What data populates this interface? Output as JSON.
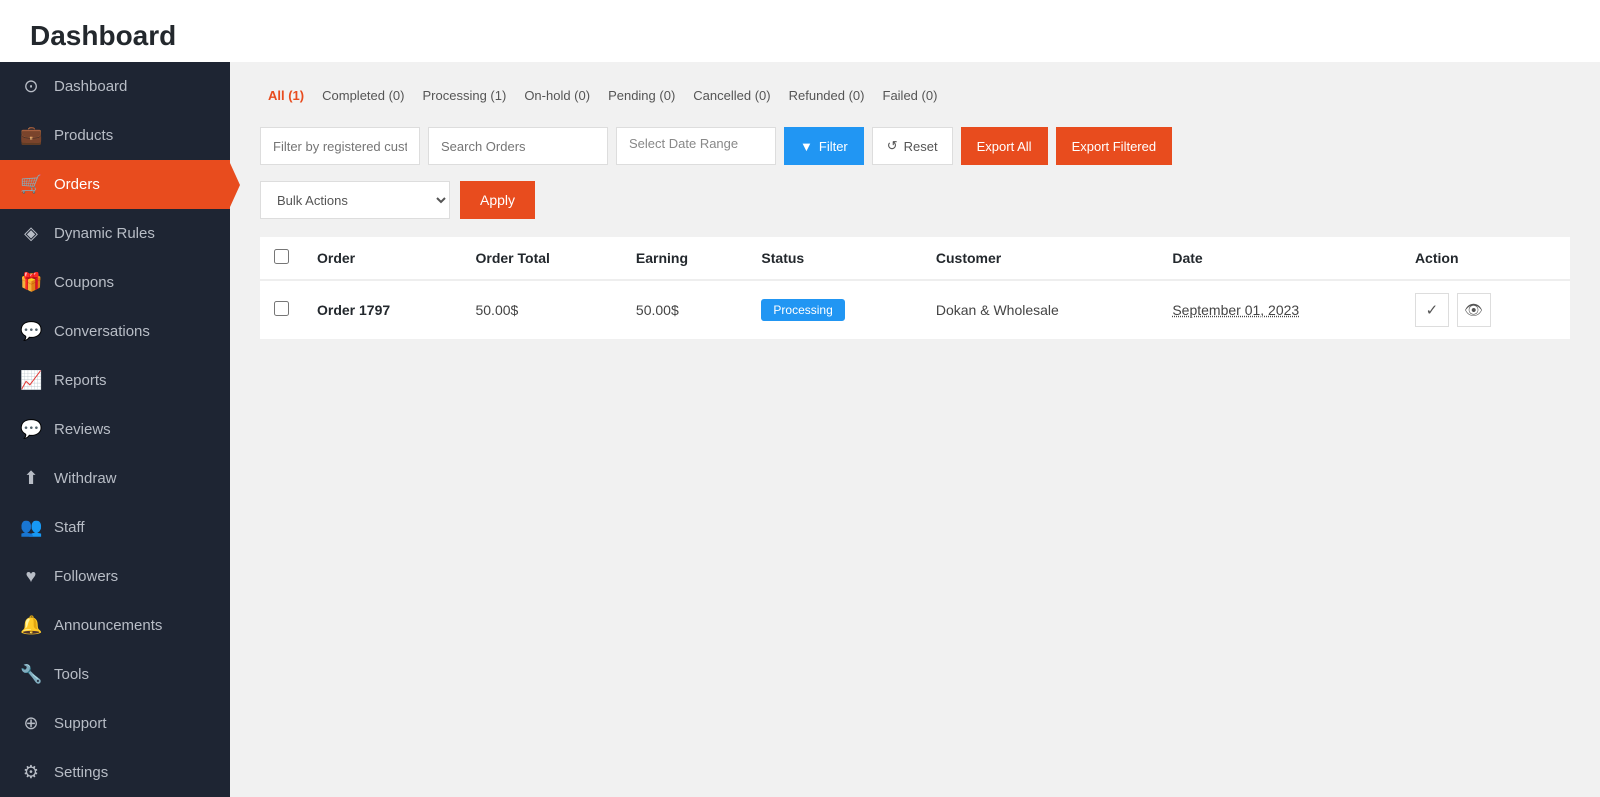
{
  "page": {
    "title": "Dashboard"
  },
  "sidebar": {
    "items": [
      {
        "id": "dashboard",
        "label": "Dashboard",
        "icon": "⊙",
        "active": false
      },
      {
        "id": "products",
        "label": "Products",
        "icon": "💼",
        "active": false
      },
      {
        "id": "orders",
        "label": "Orders",
        "icon": "🛒",
        "active": true
      },
      {
        "id": "dynamic-rules",
        "label": "Dynamic Rules",
        "icon": "◈",
        "active": false
      },
      {
        "id": "coupons",
        "label": "Coupons",
        "icon": "🎁",
        "active": false
      },
      {
        "id": "conversations",
        "label": "Conversations",
        "icon": "💬",
        "active": false
      },
      {
        "id": "reports",
        "label": "Reports",
        "icon": "📈",
        "active": false
      },
      {
        "id": "reviews",
        "label": "Reviews",
        "icon": "💬",
        "active": false
      },
      {
        "id": "withdraw",
        "label": "Withdraw",
        "icon": "⬆",
        "active": false
      },
      {
        "id": "staff",
        "label": "Staff",
        "icon": "👥",
        "active": false
      },
      {
        "id": "followers",
        "label": "Followers",
        "icon": "♥",
        "active": false
      },
      {
        "id": "announcements",
        "label": "Announcements",
        "icon": "🔔",
        "active": false
      },
      {
        "id": "tools",
        "label": "Tools",
        "icon": "🔧",
        "active": false
      },
      {
        "id": "support",
        "label": "Support",
        "icon": "⊕",
        "active": false
      },
      {
        "id": "settings",
        "label": "Settings",
        "icon": "⚙",
        "active": false
      }
    ]
  },
  "filter_tabs": [
    {
      "label": "All (1)",
      "key": "all",
      "active": true
    },
    {
      "label": "Completed (0)",
      "key": "completed",
      "active": false
    },
    {
      "label": "Processing (1)",
      "key": "processing",
      "active": false
    },
    {
      "label": "On-hold (0)",
      "key": "on-hold",
      "active": false
    },
    {
      "label": "Pending (0)",
      "key": "pending",
      "active": false
    },
    {
      "label": "Cancelled (0)",
      "key": "cancelled",
      "active": false
    },
    {
      "label": "Refunded (0)",
      "key": "refunded",
      "active": false
    },
    {
      "label": "Failed (0)",
      "key": "failed",
      "active": false
    }
  ],
  "filter_bar": {
    "customer_placeholder": "Filter by registered custo",
    "search_placeholder": "Search Orders",
    "date_placeholder": "Select Date Range",
    "filter_label": "Filter",
    "reset_label": "Reset",
    "export_all_label": "Export All",
    "export_filtered_label": "Export Filtered"
  },
  "bulk_actions": {
    "placeholder": "Bulk Actions",
    "apply_label": "Apply"
  },
  "table": {
    "columns": [
      "Order",
      "Order Total",
      "Earning",
      "Status",
      "Customer",
      "Date",
      "Action"
    ],
    "rows": [
      {
        "id": "order-1797",
        "order": "Order 1797",
        "order_total": "50.00$",
        "earning": "50.00$",
        "status": "Processing",
        "status_color": "#2196f3",
        "customer": "Dokan & Wholesale",
        "date": "September 01, 2023"
      }
    ]
  }
}
